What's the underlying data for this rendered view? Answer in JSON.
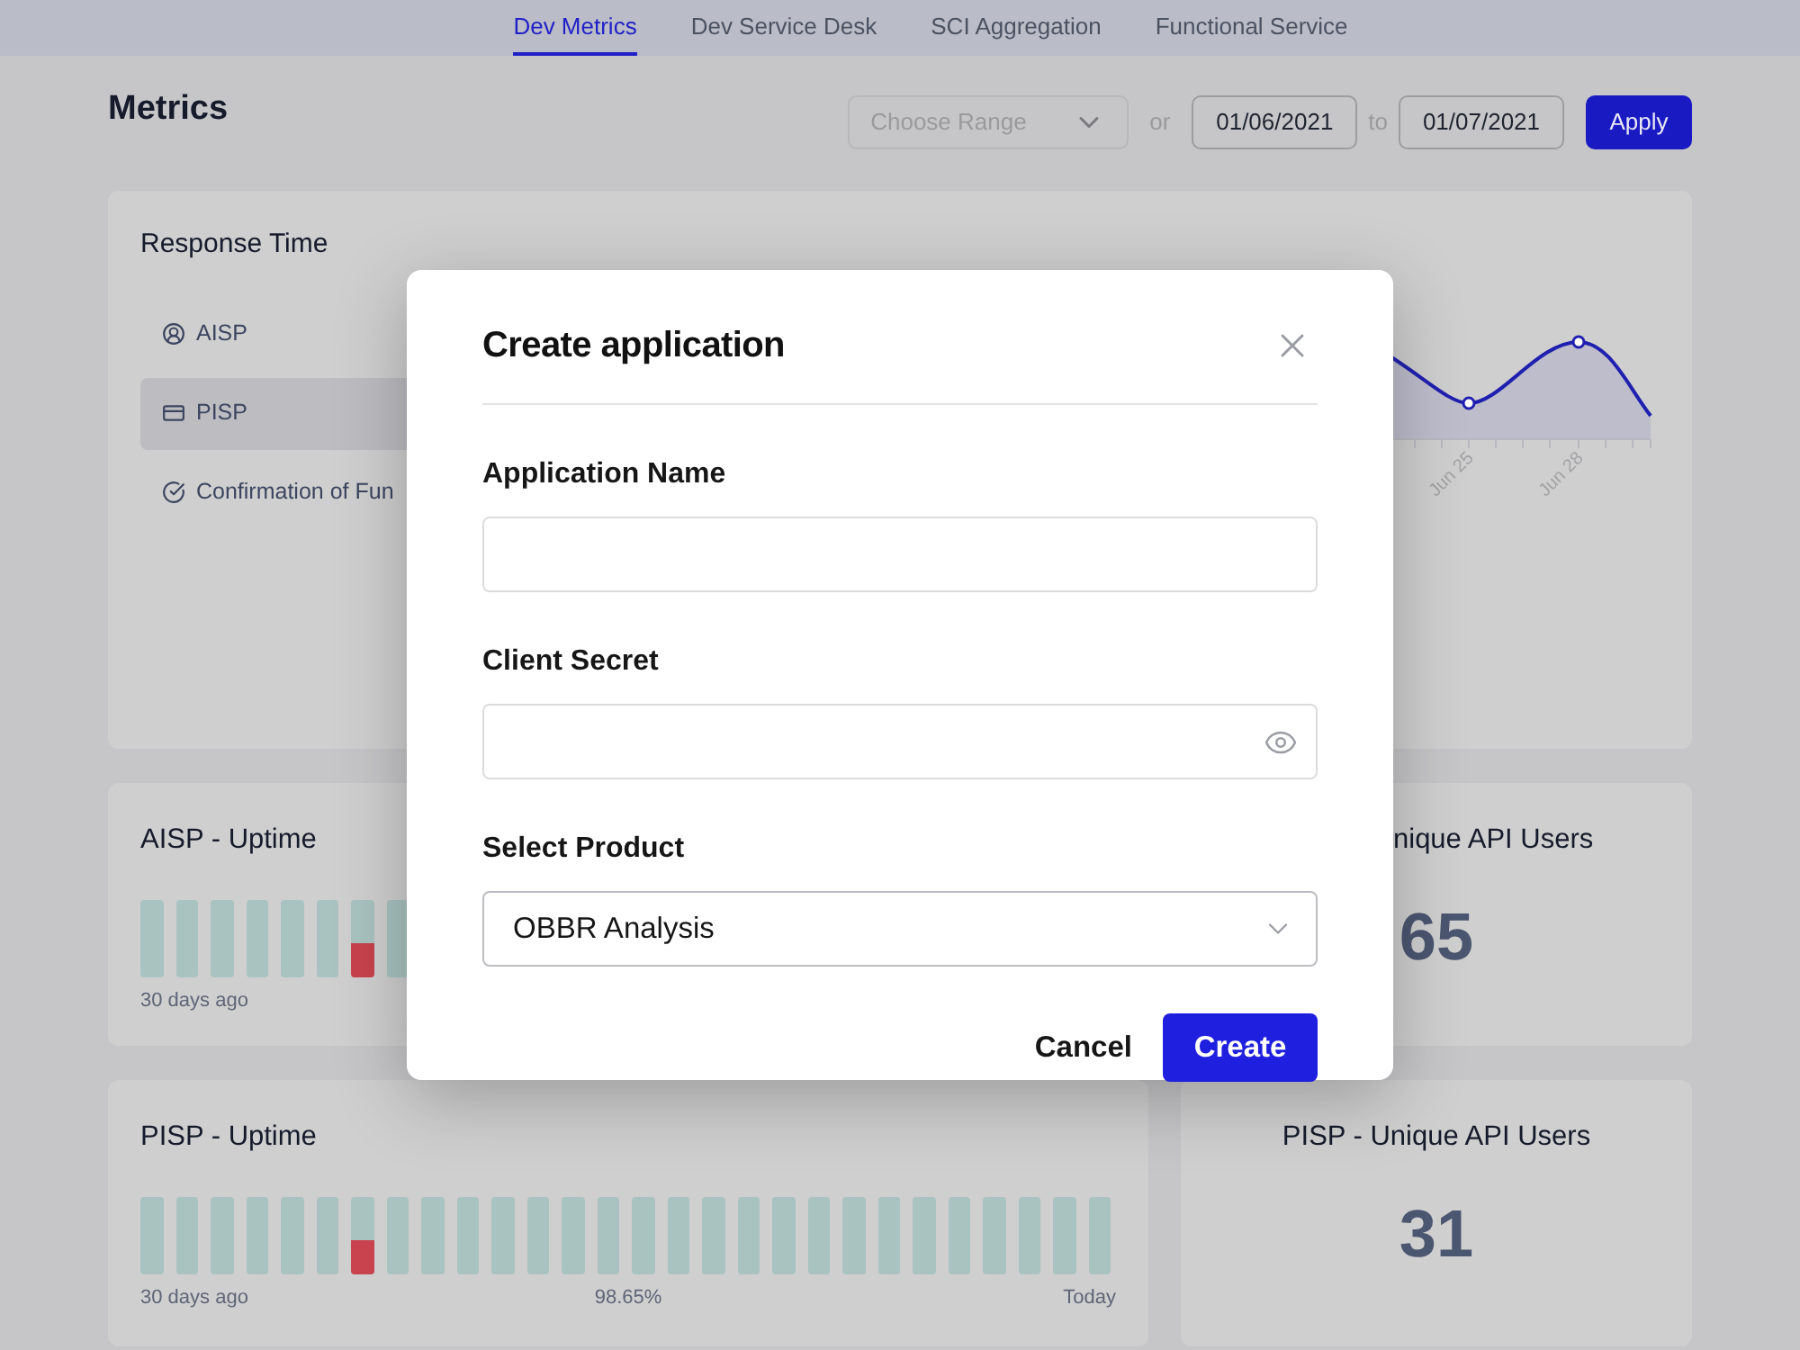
{
  "nav_tabs": [
    {
      "label": "Dev Metrics",
      "selected": true
    },
    {
      "label": "Dev Service Desk",
      "selected": false
    },
    {
      "label": "SCI Aggregation",
      "selected": false
    },
    {
      "label": "Functional Service",
      "selected": false
    }
  ],
  "header": {
    "title": "Metrics",
    "range": {
      "placeholder": "Choose Range"
    },
    "or": "or",
    "from": "01/06/2021",
    "to_label": "to",
    "to": "01/07/2021",
    "apply": "Apply"
  },
  "response_time": {
    "title": "Response Time",
    "items": [
      {
        "label": "AISP",
        "selected": false
      },
      {
        "label": "PISP",
        "selected": true
      },
      {
        "label": "Confirmation of Fun",
        "selected": false
      }
    ],
    "chart_labels": [
      "Jun 25",
      "Jun 28"
    ]
  },
  "aisp_uptime": {
    "title": "AISP - Uptime",
    "bars": [
      {
        "down": false
      },
      {
        "down": false
      },
      {
        "down": false
      },
      {
        "down": false
      },
      {
        "down": false
      },
      {
        "down": false
      },
      {
        "down": true,
        "level": 0.45
      },
      {
        "down": false
      }
    ],
    "start": "30 days ago"
  },
  "aisp_users": {
    "title": "nique API Users",
    "value": "65"
  },
  "pisp_uptime": {
    "title": "PISP - Uptime",
    "bars": [
      {
        "down": false
      },
      {
        "down": false
      },
      {
        "down": false
      },
      {
        "down": false
      },
      {
        "down": false
      },
      {
        "down": false
      },
      {
        "down": true,
        "level": 0.45
      },
      {
        "down": false
      },
      {
        "down": false
      },
      {
        "down": false
      },
      {
        "down": false
      },
      {
        "down": false
      },
      {
        "down": false
      },
      {
        "down": false
      },
      {
        "down": false
      },
      {
        "down": false
      },
      {
        "down": false
      },
      {
        "down": false
      },
      {
        "down": false
      },
      {
        "down": false
      },
      {
        "down": false
      },
      {
        "down": false
      },
      {
        "down": false
      },
      {
        "down": false
      },
      {
        "down": false
      },
      {
        "down": false
      },
      {
        "down": false
      },
      {
        "down": false
      }
    ],
    "start": "30 days ago",
    "percent": "98.65%",
    "end": "Today"
  },
  "pisp_users": {
    "title": "PISP - Unique API Users",
    "value": "31"
  },
  "dialog": {
    "title": "Create application",
    "fields": [
      {
        "label": "Application Name",
        "kind": "text"
      },
      {
        "label": "Client Secret",
        "kind": "secret"
      },
      {
        "label": "Select Product",
        "kind": "select",
        "value": "OBBR Analysis"
      }
    ],
    "cancel": "Cancel",
    "create": "Create"
  }
}
